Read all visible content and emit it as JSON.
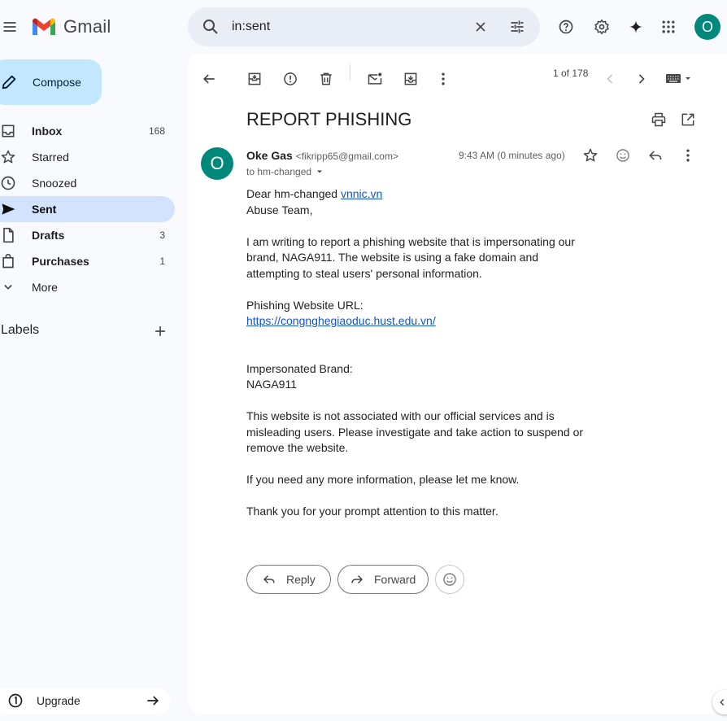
{
  "app": {
    "name": "Gmail"
  },
  "search": {
    "query": "in:sent"
  },
  "user": {
    "initial": "O"
  },
  "compose": {
    "label": "Compose"
  },
  "nav": [
    {
      "label": "Inbox",
      "count": "168"
    },
    {
      "label": "Starred",
      "count": ""
    },
    {
      "label": "Snoozed",
      "count": ""
    },
    {
      "label": "Sent",
      "count": ""
    },
    {
      "label": "Drafts",
      "count": "3"
    },
    {
      "label": "Purchases",
      "count": "1"
    },
    {
      "label": "More",
      "count": ""
    }
  ],
  "labels": {
    "title": "Labels"
  },
  "upgrade": {
    "label": "Upgrade"
  },
  "toolbar": {
    "pager": "1 of 178"
  },
  "email": {
    "subject": "REPORT PHISHING",
    "sender_initial": "O",
    "sender_name": "Oke Gas",
    "sender_email": "<fikripp65@gmail.com>",
    "to": "to hm-changed",
    "time": "9:43 AM (0 minutes ago)",
    "greeting_prefix": "Dear hm-changed ",
    "greeting_link": "vnnic.vn",
    "greeting_line2": "Abuse Team,",
    "para1": "I am writing to report a phishing website that is impersonating our brand, NAGA911. The website is using a fake domain and attempting to steal users' personal information.",
    "url_label": "Phishing Website URL:",
    "url": "https://congnghegiaoduc.hust.edu.vn/",
    "brand_label": "Impersonated Brand:",
    "brand": "NAGA911",
    "para2": "This website is not associated with our official services and is misleading users. Please investigate and take action to suspend or remove the website.",
    "para3": "If you need any more information, please let me know.",
    "para4": "Thank you for your prompt attention to this matter."
  },
  "actions": {
    "reply": "Reply",
    "forward": "Forward"
  }
}
